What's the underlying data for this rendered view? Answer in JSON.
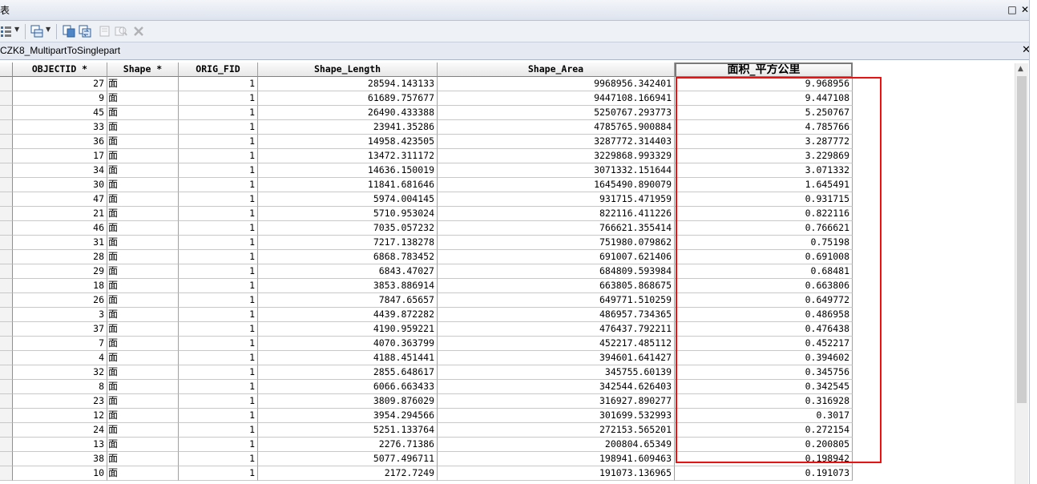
{
  "window": {
    "title": "表",
    "restore_label": "□",
    "close_label": "✕"
  },
  "toolbar": {
    "items": [
      "table-options-icon",
      "related-tables-icon",
      "select-by-attributes-icon",
      "switch-selection-icon",
      "clear-selection-icon",
      "zoom-to-selected-icon",
      "delete-selected-icon"
    ]
  },
  "tab": {
    "name": "CZK8_MultipartToSinglepart",
    "close_label": "✕"
  },
  "columns": [
    "OBJECTID *",
    "Shape *",
    "ORIG_FID",
    "Shape_Length",
    "Shape_Area",
    "面积_平方公里"
  ],
  "rows": [
    [
      "27",
      "面",
      "1",
      "28594.143133",
      "9968956.342401",
      "9.968956"
    ],
    [
      "9",
      "面",
      "1",
      "61689.757677",
      "9447108.166941",
      "9.447108"
    ],
    [
      "45",
      "面",
      "1",
      "26490.433388",
      "5250767.293773",
      "5.250767"
    ],
    [
      "33",
      "面",
      "1",
      "23941.35286",
      "4785765.900884",
      "4.785766"
    ],
    [
      "36",
      "面",
      "1",
      "14958.423505",
      "3287772.314403",
      "3.287772"
    ],
    [
      "17",
      "面",
      "1",
      "13472.311172",
      "3229868.993329",
      "3.229869"
    ],
    [
      "34",
      "面",
      "1",
      "14636.150019",
      "3071332.151644",
      "3.071332"
    ],
    [
      "30",
      "面",
      "1",
      "11841.681646",
      "1645490.890079",
      "1.645491"
    ],
    [
      "47",
      "面",
      "1",
      "5974.004145",
      "931715.471959",
      "0.931715"
    ],
    [
      "21",
      "面",
      "1",
      "5710.953024",
      "822116.411226",
      "0.822116"
    ],
    [
      "46",
      "面",
      "1",
      "7035.057232",
      "766621.355414",
      "0.766621"
    ],
    [
      "31",
      "面",
      "1",
      "7217.138278",
      "751980.079862",
      "0.75198"
    ],
    [
      "28",
      "面",
      "1",
      "6868.783452",
      "691007.621406",
      "0.691008"
    ],
    [
      "29",
      "面",
      "1",
      "6843.47027",
      "684809.593984",
      "0.68481"
    ],
    [
      "18",
      "面",
      "1",
      "3853.886914",
      "663805.868675",
      "0.663806"
    ],
    [
      "26",
      "面",
      "1",
      "7847.65657",
      "649771.510259",
      "0.649772"
    ],
    [
      "3",
      "面",
      "1",
      "4439.872282",
      "486957.734365",
      "0.486958"
    ],
    [
      "37",
      "面",
      "1",
      "4190.959221",
      "476437.792211",
      "0.476438"
    ],
    [
      "7",
      "面",
      "1",
      "4070.363799",
      "452217.485112",
      "0.452217"
    ],
    [
      "4",
      "面",
      "1",
      "4188.451441",
      "394601.641427",
      "0.394602"
    ],
    [
      "32",
      "面",
      "1",
      "2855.648617",
      "345755.60139",
      "0.345756"
    ],
    [
      "8",
      "面",
      "1",
      "6066.663433",
      "342544.626403",
      "0.342545"
    ],
    [
      "23",
      "面",
      "1",
      "3809.876029",
      "316927.890277",
      "0.316928"
    ],
    [
      "12",
      "面",
      "1",
      "3954.294566",
      "301699.532993",
      "0.3017"
    ],
    [
      "24",
      "面",
      "1",
      "5251.133764",
      "272153.565201",
      "0.272154"
    ],
    [
      "13",
      "面",
      "1",
      "2276.71386",
      "200804.65349",
      "0.200805"
    ],
    [
      "38",
      "面",
      "1",
      "5077.496711",
      "198941.609463",
      "0.198942"
    ],
    [
      "10",
      "面",
      "1",
      "2172.7249",
      "191073.136965",
      "0.191073"
    ]
  ],
  "colors": {
    "highlight_box": "#ee1111"
  }
}
